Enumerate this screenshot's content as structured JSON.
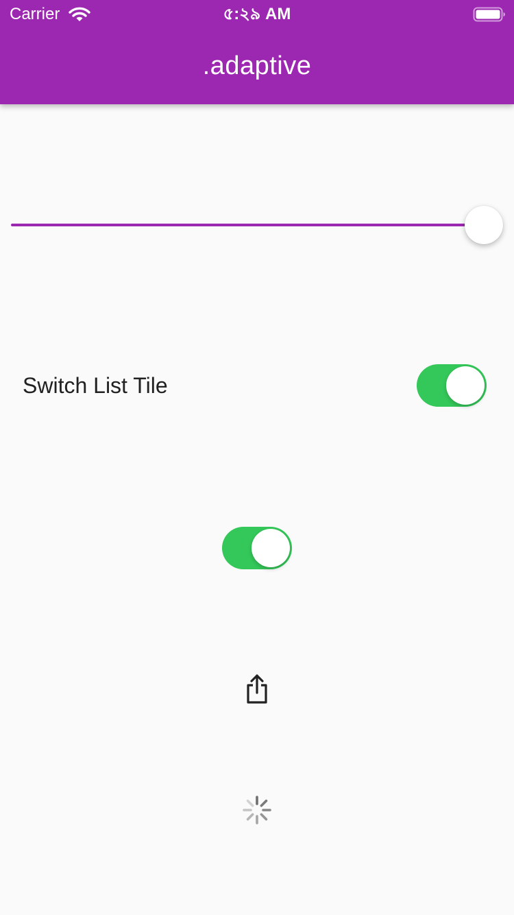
{
  "status_bar": {
    "carrier": "Carrier",
    "time": "৫:২৯ AM",
    "wifi_icon": "wifi-icon",
    "battery_icon": "battery-icon",
    "battery_level": 1.0
  },
  "app_bar": {
    "title": ".adaptive",
    "color": "#9c27b0"
  },
  "slider": {
    "value": 1.0,
    "active_color": "#9c27b0"
  },
  "switch_list_tile": {
    "title": "Switch List Tile",
    "value": true
  },
  "switch": {
    "value": true
  },
  "switch_color": "#34c759",
  "share_button": {
    "icon": "share-icon"
  },
  "activity_indicator": {
    "icon": "spinner-icon"
  }
}
